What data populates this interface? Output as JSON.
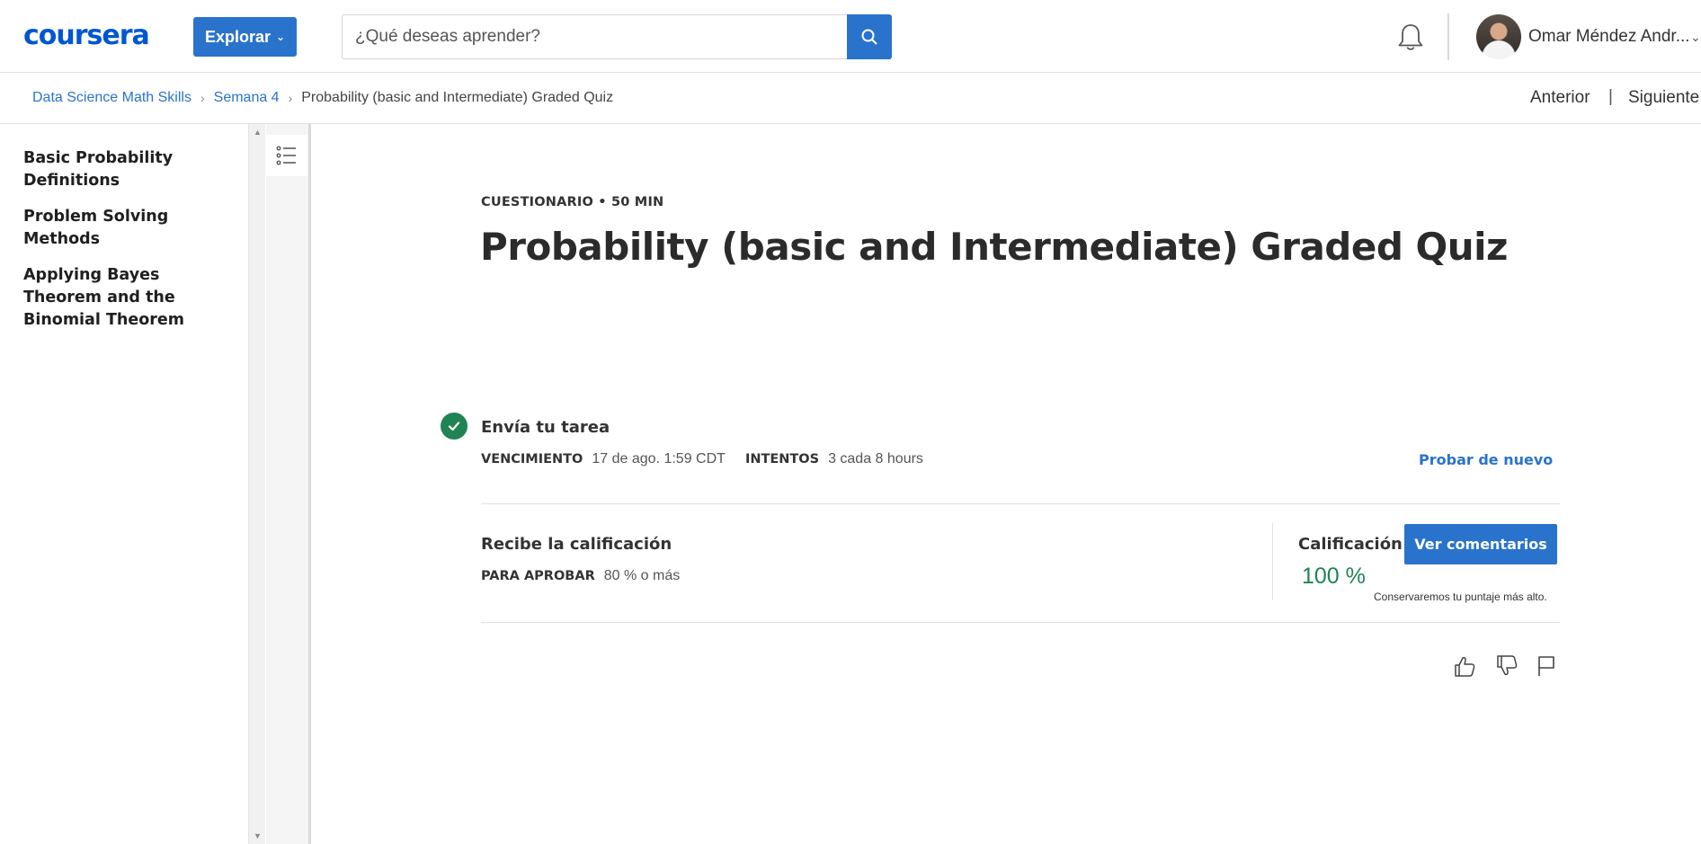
{
  "header": {
    "logo_text": "coursera",
    "explore_label": "Explorar",
    "search_placeholder": "¿Qué deseas aprender?",
    "user_name": "Omar Méndez Andr..."
  },
  "breadcrumb": {
    "items": [
      "Data Science Math Skills",
      "Semana 4"
    ],
    "current": "Probability (basic and Intermediate) Graded Quiz",
    "prev_label": "Anterior",
    "separator": "|",
    "next_label": "Siguiente"
  },
  "sidebar": {
    "items": [
      {
        "label": "Basic Probability Definitions"
      },
      {
        "label": "Problem Solving Methods"
      },
      {
        "label": "Applying Bayes Theorem and the Binomial Theorem"
      }
    ]
  },
  "main": {
    "eyebrow": "CUESTIONARIO • 50 MIN",
    "title": "Probability (basic and Intermediate) Graded Quiz",
    "submit": {
      "title": "Envía tu tarea",
      "due_label": "VENCIMIENTO",
      "due_value": "17 de ago. 1:59 CDT",
      "attempts_label": "INTENTOS",
      "attempts_value": "3 cada 8 hours",
      "retry_label": "Probar de nuevo"
    },
    "grade": {
      "title": "Recibe la calificación",
      "pass_label": "PARA APROBAR",
      "pass_value": "80 % o más",
      "grade_label": "Calificación",
      "grade_value": "100 %",
      "feedback_label": "Ver comentarios",
      "keep_note": "Conservaremos tu puntaje más alto."
    }
  },
  "colors": {
    "brand": "#0056d2",
    "accent": "#2a73cc",
    "success": "#1f8354"
  },
  "icons": [
    "search-icon",
    "bell-icon",
    "outline-icon",
    "check-icon",
    "thumbs-up-icon",
    "thumbs-down-icon",
    "flag-icon"
  ]
}
